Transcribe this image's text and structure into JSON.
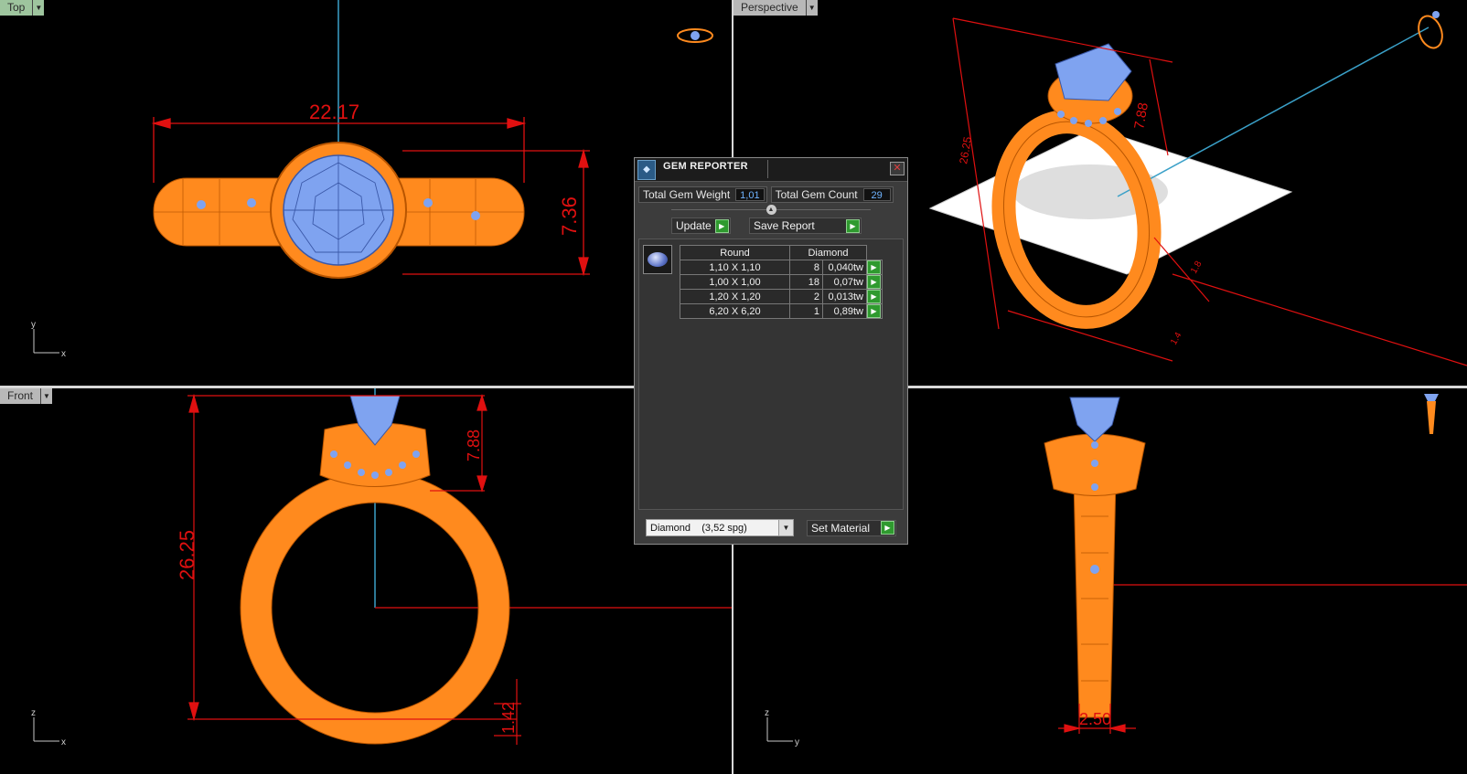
{
  "viewports": {
    "top": {
      "label": "Top",
      "dim_width": "22.17",
      "dim_height": "7.36",
      "axis_v": "y",
      "axis_h": "x"
    },
    "perspective": {
      "label": "Perspective",
      "dim_tall": "26.25",
      "dim_head": "7.88",
      "dim_band": "1.8",
      "dim_shank": "1.4"
    },
    "front": {
      "label": "Front",
      "dim_total": "26.25",
      "dim_head": "7.88",
      "dim_band": "1.42",
      "axis_v": "z",
      "axis_h": "x"
    },
    "right": {
      "dim_width": "2.50",
      "axis_v": "z",
      "axis_h": "y"
    }
  },
  "gem_reporter": {
    "title": "GEM REPORTER",
    "total_weight_label": "Total Gem Weight",
    "total_weight_value": "1,01",
    "total_count_label": "Total Gem Count",
    "total_count_value": "29",
    "update_label": "Update",
    "save_label": "Save Report",
    "table": {
      "shape_header": "Round",
      "material_header": "Diamond",
      "rows": [
        {
          "size": "1,10 X 1,10",
          "count": "8",
          "weight": "0,040tw"
        },
        {
          "size": "1,00 X 1,00",
          "count": "18",
          "weight": "0,07tw"
        },
        {
          "size": "1,20 X 1,20",
          "count": "2",
          "weight": "0,013tw"
        },
        {
          "size": "6,20 X 6,20",
          "count": "1",
          "weight": "0,89tw"
        }
      ]
    },
    "material_select": "Diamond    (3,52 spg)",
    "set_material_label": "Set Material"
  },
  "colors": {
    "ring": "#ff8a1e",
    "gem": "#7fa3f0",
    "dimension": "#e01010",
    "axis": "#3aa0c8"
  }
}
